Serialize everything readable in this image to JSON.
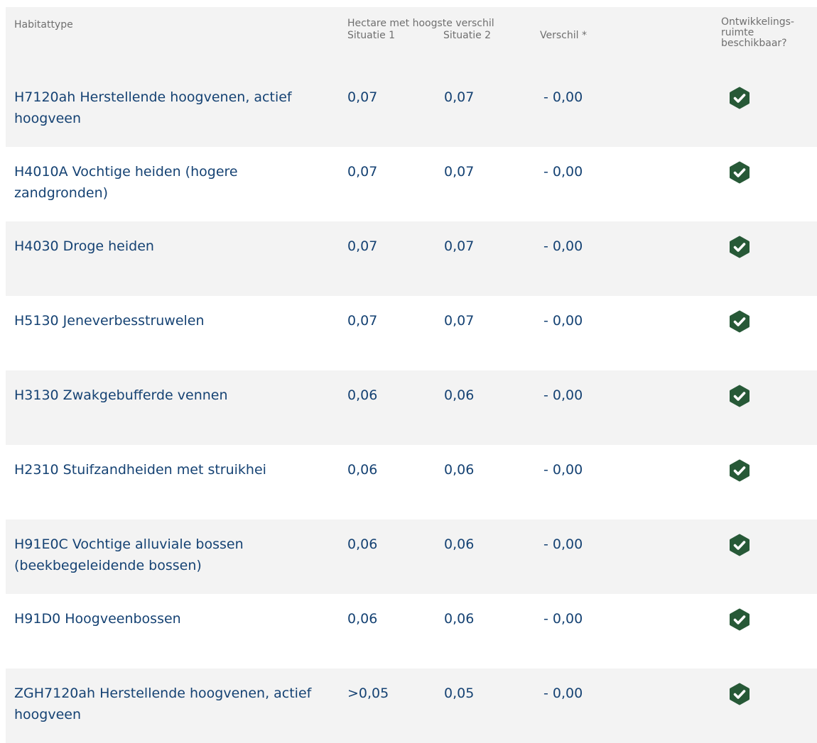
{
  "header": {
    "habitat_type": "Habitattype",
    "group_label": "Hectare met hoogste verschil",
    "situation1": "Situatie 1",
    "situation2": "Situatie 2",
    "difference": "Verschil *",
    "development_line1": "Ontwikkelings-",
    "development_line2": "ruimte",
    "development_line3": "beschikbaar?"
  },
  "colors": {
    "accent": "#154273",
    "check": "#275937",
    "header_text": "#6f6f6f",
    "stripe": "#f3f3f3"
  },
  "rows": [
    {
      "name": "H7120ah Herstellende hoogvenen, actief hoogveen",
      "s1": "0,07",
      "s2": "0,07",
      "diff": "- 0,00",
      "available_icon": "check-circle-icon"
    },
    {
      "name": "H4010A Vochtige heiden (hogere zandgronden)",
      "s1": "0,07",
      "s2": "0,07",
      "diff": "- 0,00",
      "available_icon": "check-circle-icon"
    },
    {
      "name": "H4030 Droge heiden",
      "s1": "0,07",
      "s2": "0,07",
      "diff": "- 0,00",
      "available_icon": "check-circle-icon"
    },
    {
      "name": "H5130 Jeneverbesstruwelen",
      "s1": "0,07",
      "s2": "0,07",
      "diff": "- 0,00",
      "available_icon": "check-circle-icon"
    },
    {
      "name": "H3130 Zwakgebufferde vennen",
      "s1": "0,06",
      "s2": "0,06",
      "diff": "- 0,00",
      "available_icon": "check-circle-icon"
    },
    {
      "name": "H2310 Stuifzandheiden met struikhei",
      "s1": "0,06",
      "s2": "0,06",
      "diff": "- 0,00",
      "available_icon": "check-circle-icon"
    },
    {
      "name": "H91E0C Vochtige alluviale bossen (beekbegeleidende bossen)",
      "s1": "0,06",
      "s2": "0,06",
      "diff": "- 0,00",
      "available_icon": "check-circle-icon"
    },
    {
      "name": "H91D0 Hoogveenbossen",
      "s1": "0,06",
      "s2": "0,06",
      "diff": "- 0,00",
      "available_icon": "check-circle-icon"
    },
    {
      "name": "ZGH7120ah Herstellende hoogvenen, actief hoogveen",
      "s1": ">0,05",
      "s2": "0,05",
      "diff": "- 0,00",
      "available_icon": "check-circle-icon"
    }
  ]
}
